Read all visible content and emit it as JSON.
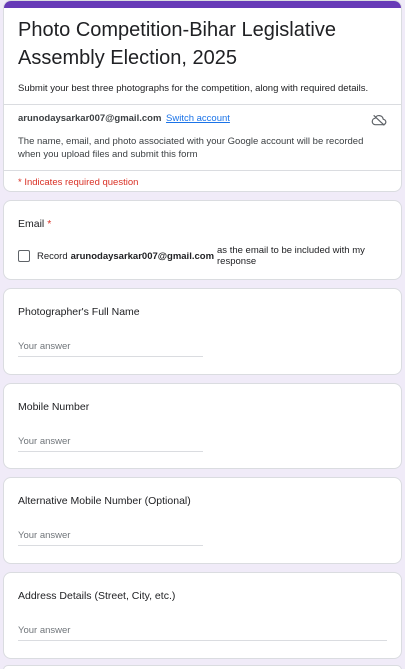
{
  "form": {
    "title": "Photo Competition-Bihar Legislative Assembly Election, 2025",
    "description": "Submit your best three photographs for the competition, along with required details.",
    "account_email": "arunodaysarkar007@gmail.com",
    "switch_account_label": "Switch account",
    "account_note": "The name, email, and photo associated with your Google account will be recorded when you upload files and submit this form",
    "required_note": "* Indicates required question",
    "accent_color": "#673ab7",
    "background_color": "#f0ebf8"
  },
  "email_question": {
    "label": "Email",
    "required_mark": "*",
    "checkbox_prefix": "Record",
    "checkbox_email": "arunodaysarkar007@gmail.com",
    "checkbox_suffix": "as the email to be included with my response",
    "checked": false
  },
  "questions": [
    {
      "label": "Photographer's Full Name",
      "placeholder": "Your answer"
    },
    {
      "label": "Mobile Number",
      "placeholder": "Your answer"
    },
    {
      "label": "Alternative Mobile Number (Optional)",
      "placeholder": "Your answer"
    },
    {
      "label": "Address Details (Street, City, etc.)",
      "placeholder": "Your answer"
    }
  ],
  "icons": {
    "account": "cloud-off-icon"
  }
}
